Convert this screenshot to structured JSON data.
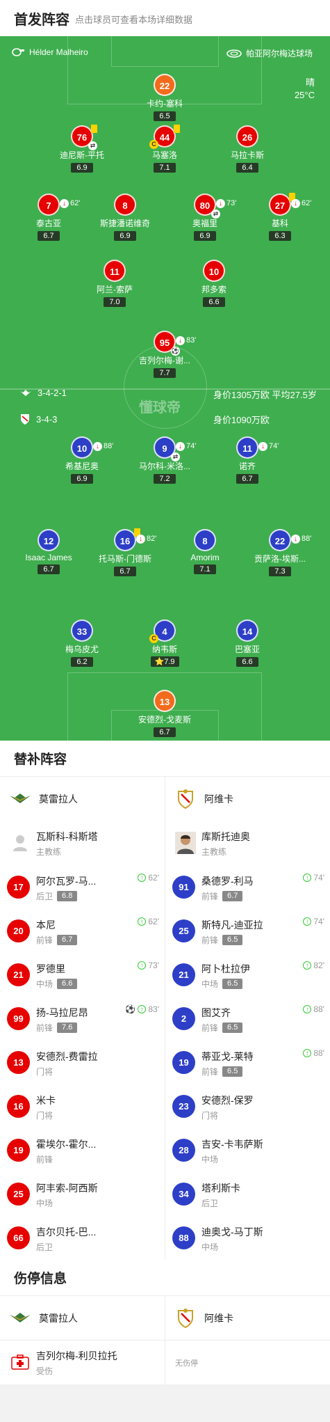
{
  "header": {
    "title": "首发阵容",
    "subtitle": "点击球员可查看本场详细数据"
  },
  "field": {
    "home_coach": "Hélder Malheiro",
    "venue": "帕亚阿尔梅达球场",
    "weather": "晴",
    "temp": "25°C",
    "watermark": "懂球帝",
    "home_formation": "3-4-2-1",
    "home_value": "身价1305万欧 平均27.5岁",
    "away_formation": "3-4-3",
    "away_value": "身价1090万欧",
    "players": [
      {
        "num": "22",
        "name": "卡约-塞科",
        "rating": "6.5",
        "color": "o"
      },
      {
        "num": "76",
        "name": "迪尼斯-平托",
        "rating": "6.9",
        "color": "r",
        "yellow": true,
        "swap": true
      },
      {
        "num": "44",
        "name": "马塞洛",
        "rating": "7.1",
        "color": "r",
        "yellow": true,
        "captain": true
      },
      {
        "num": "26",
        "name": "马拉卡斯",
        "rating": "6.4",
        "color": "r"
      },
      {
        "num": "7",
        "name": "泰古亚",
        "rating": "6.7",
        "color": "r",
        "sub": "62'"
      },
      {
        "num": "8",
        "name": "斯捷潘诺维奇",
        "rating": "6.9",
        "color": "r"
      },
      {
        "num": "80",
        "name": "奥福里",
        "rating": "6.9",
        "color": "r",
        "sub": "73'",
        "swap": true
      },
      {
        "num": "27",
        "name": "基科",
        "rating": "6.3",
        "color": "r",
        "yellow": true,
        "sub": "62'"
      },
      {
        "num": "11",
        "name": "阿兰-索萨",
        "rating": "7.0",
        "color": "r"
      },
      {
        "num": "10",
        "name": "邦多索",
        "rating": "6.6",
        "color": "r"
      },
      {
        "num": "95",
        "name": "吉列尔梅-谢...",
        "rating": "7.7",
        "color": "r",
        "sub": "83'",
        "goal": true
      },
      {
        "num": "10",
        "name": "希基尼奥",
        "rating": "6.9",
        "color": "b",
        "sub": "88'"
      },
      {
        "num": "9",
        "name": "马尔科-米洛...",
        "rating": "7.2",
        "color": "b",
        "sub": "74'",
        "swap": true
      },
      {
        "num": "11",
        "name": "诺齐",
        "rating": "6.7",
        "color": "b",
        "sub": "74'"
      },
      {
        "num": "12",
        "name": "Isaac James",
        "rating": "6.7",
        "color": "b"
      },
      {
        "num": "16",
        "name": "托马斯-门德斯",
        "rating": "6.7",
        "color": "b",
        "yellow": true,
        "sub": "82'"
      },
      {
        "num": "8",
        "name": "Amorim",
        "rating": "7.1",
        "color": "b"
      },
      {
        "num": "22",
        "name": "贡萨洛-埃斯...",
        "rating": "7.3",
        "color": "b",
        "sub": "88'"
      },
      {
        "num": "33",
        "name": "梅乌皮尤",
        "rating": "6.2",
        "color": "b"
      },
      {
        "num": "4",
        "name": "纳韦斯",
        "rating": "7.9",
        "color": "b",
        "captain": true,
        "star": true
      },
      {
        "num": "14",
        "name": "巴塞亚",
        "rating": "6.6",
        "color": "b"
      },
      {
        "num": "13",
        "name": "安德烈-戈麦斯",
        "rating": "6.7",
        "color": "o"
      }
    ]
  },
  "subs": {
    "title": "替补阵容",
    "home_team": "莫雷拉人",
    "away_team": "阿维卡",
    "home_coach": {
      "name": "瓦斯科-科斯塔",
      "role": "主教练"
    },
    "away_coach": {
      "name": "库斯托迪奥",
      "role": "主教练"
    },
    "home": [
      {
        "num": "17",
        "name": "阿尔瓦罗-马...",
        "pos": "后卫",
        "rating": "6.8",
        "in": "62'"
      },
      {
        "num": "20",
        "name": "本尼",
        "pos": "前锋",
        "rating": "6.7",
        "in": "62'"
      },
      {
        "num": "21",
        "name": "罗德里",
        "pos": "中场",
        "rating": "6.6",
        "in": "73'"
      },
      {
        "num": "99",
        "name": "扬-马拉尼昂",
        "pos": "前锋",
        "rating": "7.6",
        "in": "83'",
        "goal": true
      },
      {
        "num": "13",
        "name": "安德烈-费雷拉",
        "pos": "门将"
      },
      {
        "num": "16",
        "name": "米卡",
        "pos": "门将"
      },
      {
        "num": "19",
        "name": "霍埃尔-霍尔...",
        "pos": "前锋"
      },
      {
        "num": "25",
        "name": "阿丰索-阿西斯",
        "pos": "中场"
      },
      {
        "num": "66",
        "name": "吉尔贝托-巴...",
        "pos": "后卫"
      }
    ],
    "away": [
      {
        "num": "91",
        "name": "桑德罗-利马",
        "pos": "前锋",
        "rating": "6.7",
        "in": "74'"
      },
      {
        "num": "25",
        "name": "斯特凡-迪亚拉",
        "pos": "前锋",
        "rating": "6.5",
        "in": "74'"
      },
      {
        "num": "21",
        "name": "阿卜杜拉伊",
        "pos": "中场",
        "rating": "6.5",
        "in": "82'"
      },
      {
        "num": "2",
        "name": "图艾齐",
        "pos": "前锋",
        "rating": "6.5",
        "in": "88'"
      },
      {
        "num": "19",
        "name": "蒂亚戈-莱特",
        "pos": "前锋",
        "rating": "6.5",
        "in": "88'"
      },
      {
        "num": "23",
        "name": "安德烈-保罗",
        "pos": "门将"
      },
      {
        "num": "28",
        "name": "吉安-卡韦萨斯",
        "pos": "中场"
      },
      {
        "num": "34",
        "name": "塔利斯卡",
        "pos": "后卫"
      },
      {
        "num": "88",
        "name": "迪奥戈-马丁斯",
        "pos": "中场"
      }
    ]
  },
  "injuries": {
    "title": "伤停信息",
    "home_team": "莫雷拉人",
    "away_team": "阿维卡",
    "home": [
      {
        "name": "吉列尔梅-利贝拉托",
        "status": "受伤"
      }
    ],
    "away_none": "无伤停"
  },
  "colors": {
    "pitch": "#3fae4f",
    "home": "#e60000",
    "away": "#2d3fc7",
    "gk": "#f26b1d"
  }
}
